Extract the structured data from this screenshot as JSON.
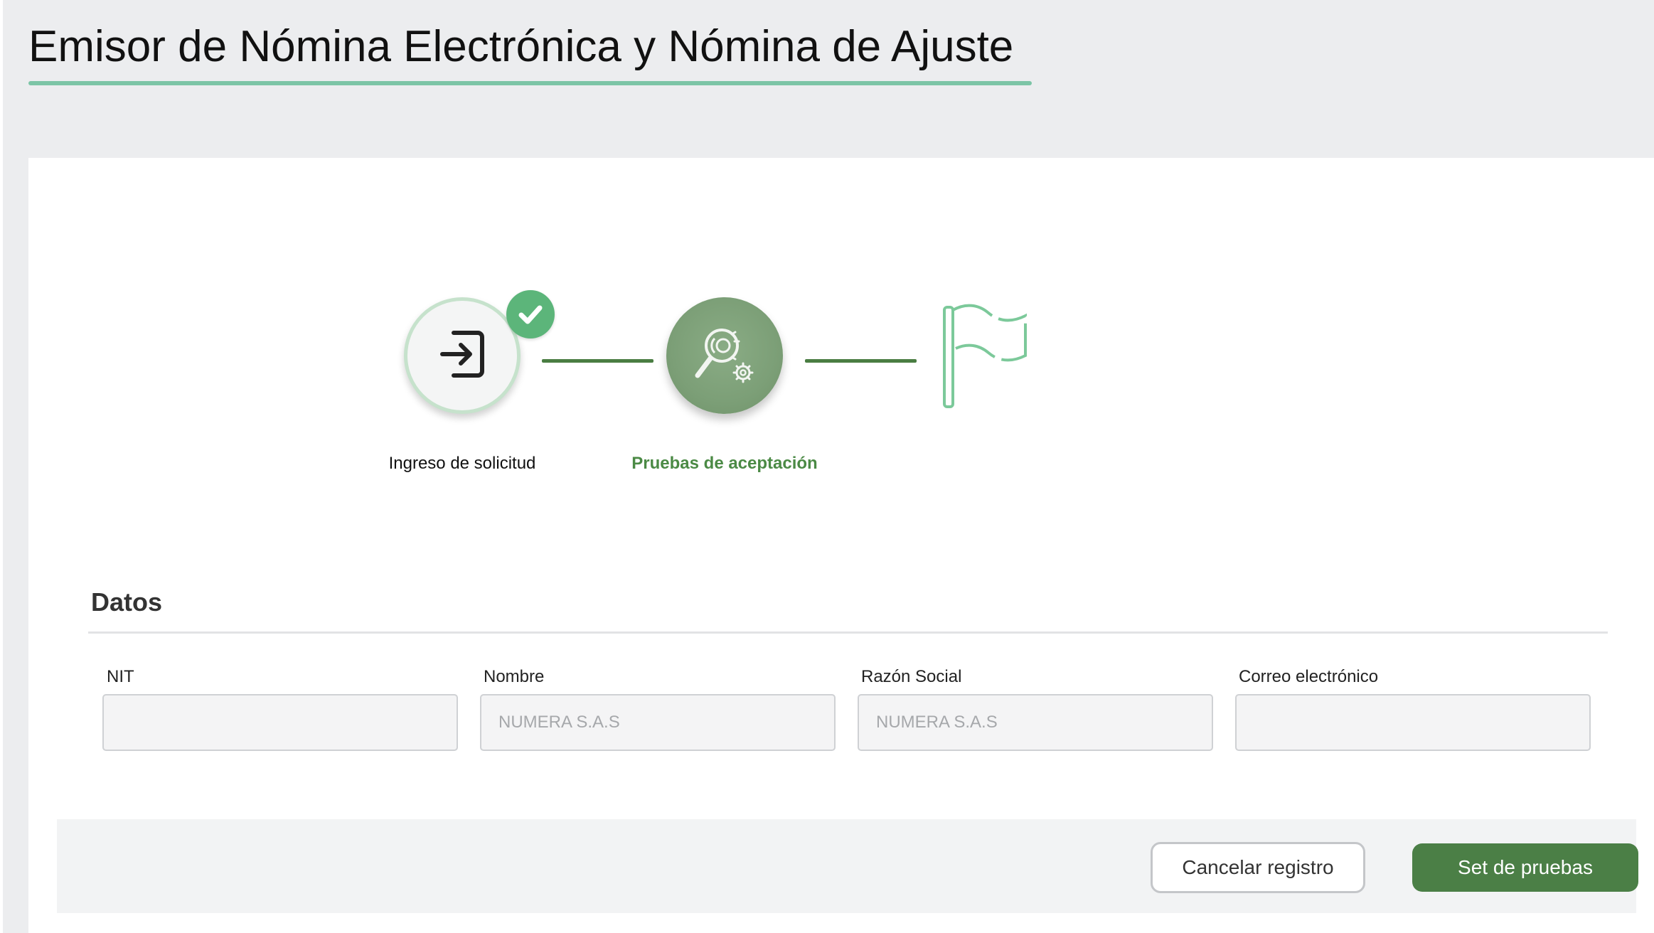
{
  "page": {
    "title": "Emisor de Nómina Electrónica y Nómina de Ajuste",
    "accent_color": "#7cc5a6"
  },
  "stepper": {
    "steps": [
      {
        "label": "Ingreso de solicitud",
        "state": "completed",
        "icon": "login-arrow-icon"
      },
      {
        "label": "Pruebas de aceptación",
        "state": "active",
        "icon": "search-gear-icon"
      },
      {
        "label": "",
        "state": "pending",
        "icon": "flag-icon"
      }
    ],
    "active_color": "#4b8a45",
    "check_color": "#5cb57a"
  },
  "section": {
    "title": "Datos"
  },
  "fields": [
    {
      "label": "NIT",
      "value": "",
      "placeholder": ""
    },
    {
      "label": "Nombre",
      "value": "",
      "placeholder": "NUMERA S.A.S"
    },
    {
      "label": "Razón Social",
      "value": "",
      "placeholder": "NUMERA S.A.S"
    },
    {
      "label": "Correo electrónico",
      "value": "",
      "placeholder": ""
    }
  ],
  "actions": {
    "cancel_label": "Cancelar registro",
    "primary_label": "Set de pruebas",
    "primary_color": "#4b7f46"
  }
}
